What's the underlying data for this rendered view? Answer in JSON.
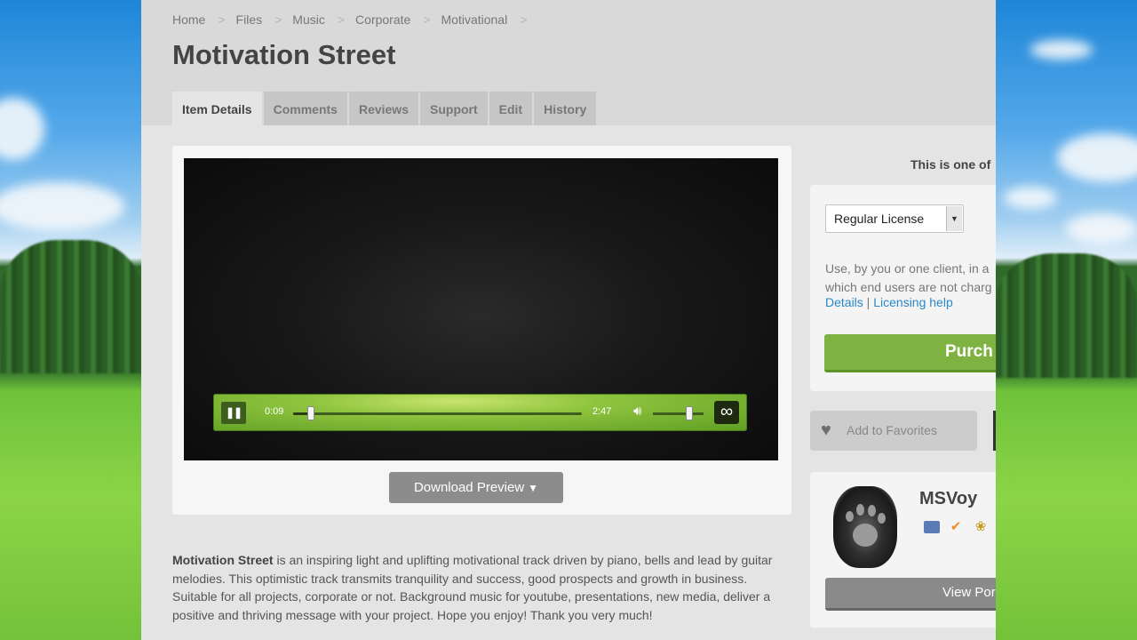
{
  "breadcrumb": [
    "Home",
    "Files",
    "Music",
    "Corporate",
    "Motivational"
  ],
  "title": "Motivation Street",
  "tabs": [
    "Item Details",
    "Comments",
    "Reviews",
    "Support",
    "Edit",
    "History"
  ],
  "player": {
    "current_time": "0:09",
    "duration": "2:47",
    "progress": 0.06,
    "volume": 0.72,
    "pause_symbol": "❚❚",
    "loop_symbol": "∞"
  },
  "download": {
    "label": "Download Preview",
    "icon": "download-icon"
  },
  "description": {
    "lead": "Motivation Street",
    "body": " is an inspiring light and uplifting motivational track driven by piano, bells and lead by guitar melodies. This optimistic track transmits tranquility and success, good prospects and growth in business. Suitable for all projects, corporate or not. Background music for youtube, presentations, new media, deliver a positive and thriving message with your project. Hope you enjoy! Thank you very much!"
  },
  "sidebar": {
    "unique_text": "This is one of",
    "license_select": "Regular License",
    "license_line1": "Use, by you or one client, in a",
    "license_line2": "which end users are not charg",
    "details_link": "Details",
    "link_separator": " | ",
    "licensing_link": "Licensing help",
    "purchase_label": "Purch",
    "favorites_label": "Add to Favorites",
    "author_name": "MSVoy",
    "portfolio_label": "View Por"
  },
  "colors": {
    "accent_green": "#7fb341",
    "link_blue": "#2a87c8"
  }
}
